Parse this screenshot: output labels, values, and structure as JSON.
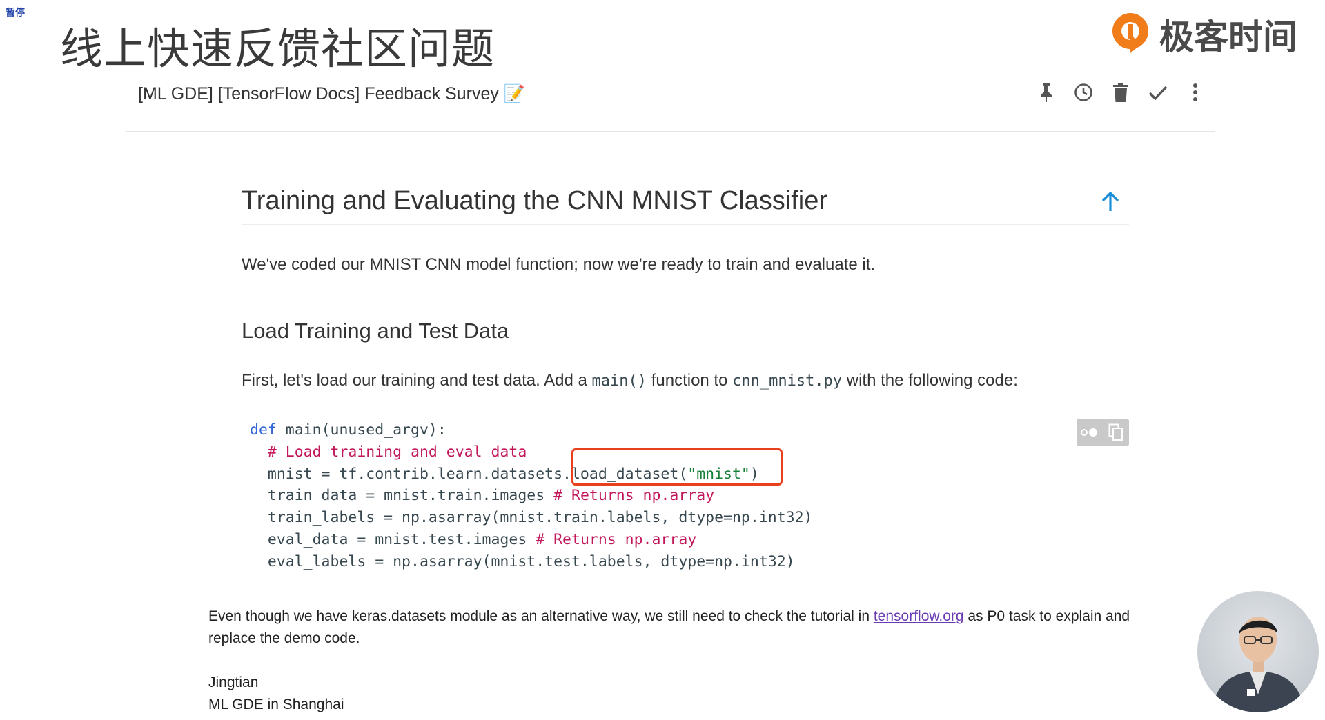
{
  "pause_tag": "暂停",
  "slide_title": "线上快速反馈社区问题",
  "brand": {
    "name": "极客时间",
    "color": "#f07d1a"
  },
  "mail": {
    "subject": "[ML GDE] [TensorFlow Docs] Feedback Survey 📝",
    "actions": [
      {
        "name": "pin-icon",
        "label": "Pin"
      },
      {
        "name": "snooze-icon",
        "label": "Snooze"
      },
      {
        "name": "delete-icon",
        "label": "Delete"
      },
      {
        "name": "done-icon",
        "label": "Mark as done"
      },
      {
        "name": "more-icon",
        "label": "More"
      }
    ]
  },
  "doc": {
    "h1": "Training and Evaluating the CNN MNIST Classifier",
    "p1": "We've coded our MNIST CNN model function; now we're ready to train and evaluate it.",
    "h2": "Load Training and Test Data",
    "p2_prefix": "First, let's load our training and test data. Add a ",
    "p2_code1": "main()",
    "p2_mid": " function to ",
    "p2_code2": "cnn_mnist.py",
    "p2_suffix": " with the following code:",
    "code": {
      "l1_kw": "def",
      "l1_rest": " main(unused_argv):",
      "l2_comment": "  # Load training and eval data",
      "l3_a": "  mnist = tf.contrib.learn.datasets.load_dataset(",
      "l3_str": "\"mnist\"",
      "l3_b": ")",
      "l4_a": "  train_data = mnist.train.images ",
      "l4_comment": "# Returns np.array",
      "l5": "  train_labels = np.asarray(mnist.train.labels, dtype=np.int32)",
      "l6_a": "  eval_data = mnist.test.images ",
      "l6_comment": "# Returns np.array",
      "l7": "  eval_labels = np.asarray(mnist.test.labels, dtype=np.int32)"
    },
    "colors": {
      "keyword": "#3367d6",
      "comment": "#c2185b",
      "string": "#188038",
      "highlight": "#e8401c"
    }
  },
  "email": {
    "body_prefix": "Even though we have keras.datasets module as an alternative way, we still need to check the tutorial in ",
    "link": "tensorflow.org",
    "body_suffix": " as P0 task to explain and replace the demo code.",
    "sig_name": "Jingtian",
    "sig_title": "ML GDE in Shanghai"
  }
}
